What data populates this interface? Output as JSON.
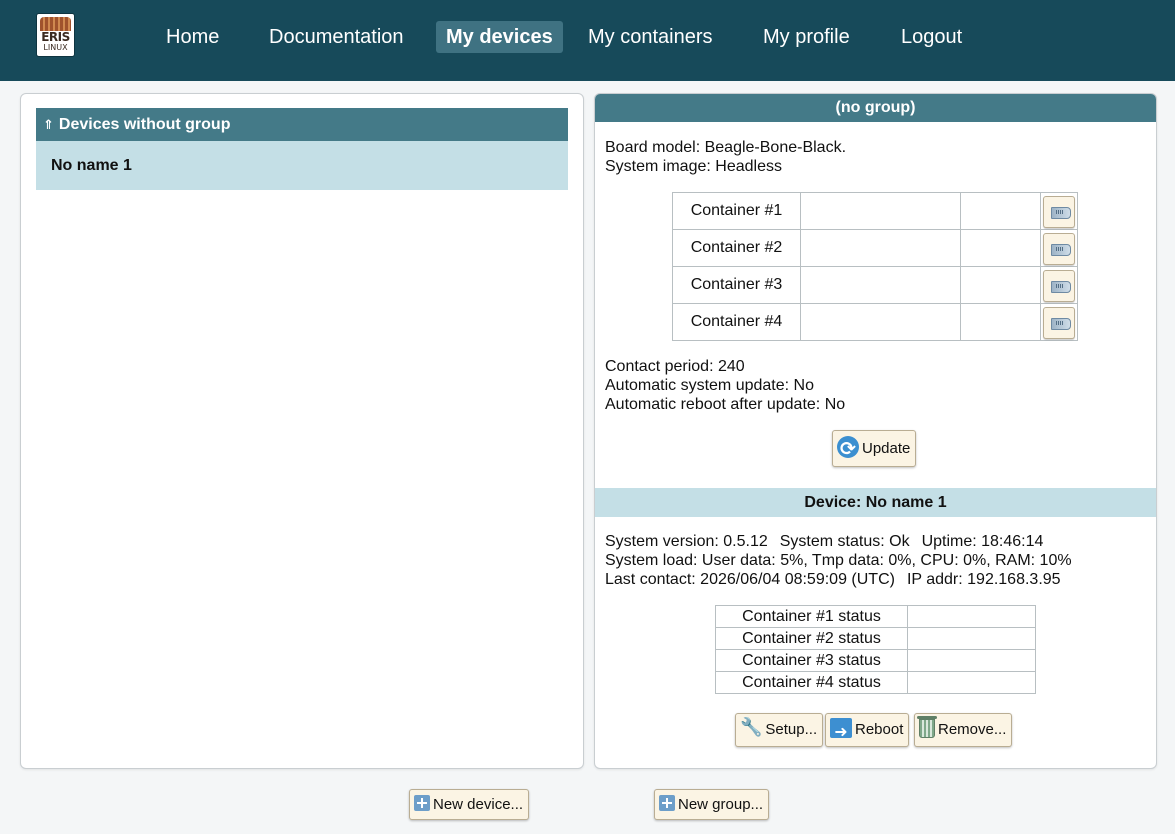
{
  "header": {
    "logo": {
      "line1": "ERIS",
      "line2": "LINUX"
    },
    "nav": [
      {
        "label": "Home",
        "active": false
      },
      {
        "label": "Documentation",
        "active": false
      },
      {
        "label": "My devices",
        "active": true
      },
      {
        "label": "My containers",
        "active": false
      },
      {
        "label": "My profile",
        "active": false
      },
      {
        "label": "Logout",
        "active": false
      }
    ],
    "bg_color": "#174a5a",
    "active_color": "#3f7282"
  },
  "left_panel": {
    "group_arrow": "⇑",
    "group_title": "Devices without group",
    "devices": [
      {
        "name": "No name 1"
      }
    ]
  },
  "right_panel": {
    "group_header": "(no group)",
    "board_model": "Board model: Beagle-Bone-Black.",
    "system_image": "System image: Headless",
    "containers": [
      {
        "label": "Container #1",
        "col2": "",
        "col3": ""
      },
      {
        "label": "Container #2",
        "col2": "",
        "col3": ""
      },
      {
        "label": "Container #3",
        "col2": "",
        "col3": ""
      },
      {
        "label": "Container #4",
        "col2": "",
        "col3": ""
      }
    ],
    "contact_period": "Contact period: 240",
    "auto_update": "Automatic system update: No",
    "auto_reboot": "Automatic reboot after update: No",
    "update_button": "Update",
    "device_header": "Device: No name 1",
    "system_version": "System version: 0.5.12",
    "system_status": "System status: Ok",
    "uptime": "Uptime: 18:46:14",
    "system_load": "System load: User data: 5%, Tmp data: 0%, CPU: 0%, RAM: 10%",
    "last_contact": "Last contact: 2026/06/04 08:59:09 (UTC)",
    "ip_addr": "IP addr: 192.168.3.95",
    "container_status": [
      {
        "label": "Container #1 status",
        "value": ""
      },
      {
        "label": "Container #2 status",
        "value": ""
      },
      {
        "label": "Container #3 status",
        "value": ""
      },
      {
        "label": "Container #4 status",
        "value": ""
      }
    ],
    "actions": {
      "setup": "Setup...",
      "reboot": "Reboot",
      "remove": "Remove..."
    }
  },
  "footer": {
    "new_device": "New device...",
    "new_group": "New group..."
  }
}
